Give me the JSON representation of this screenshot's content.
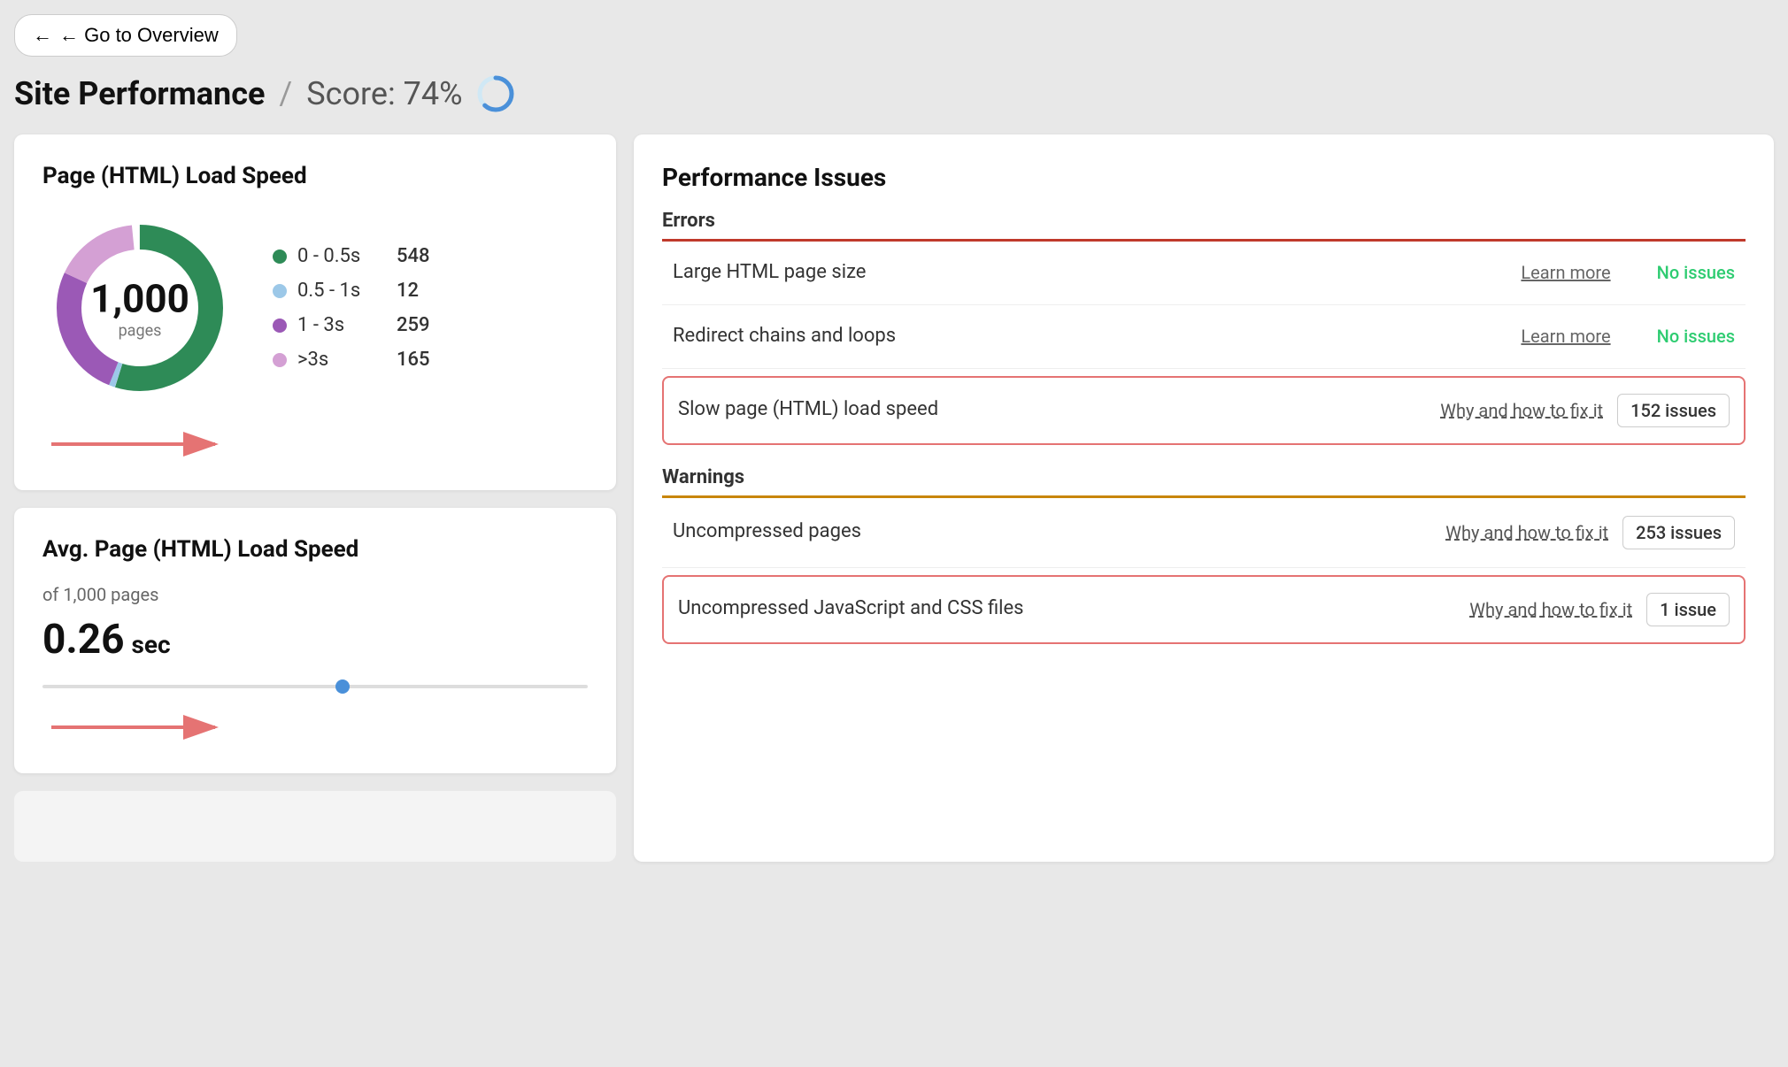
{
  "nav": {
    "back_button": "← Go to Overview"
  },
  "header": {
    "title": "Site Performance",
    "divider": "/",
    "score_label": "Score: 74%"
  },
  "left_panel": {
    "load_speed_card": {
      "title": "Page (HTML) Load Speed",
      "donut": {
        "total": "1,000",
        "label": "pages"
      },
      "legend": [
        {
          "color": "#2e8b57",
          "range": "0 - 0.5s",
          "count": "548"
        },
        {
          "color": "#9cc8e8",
          "range": "0.5 - 1s",
          "count": "12"
        },
        {
          "color": "#9b59b6",
          "range": "1 - 3s",
          "count": "259"
        },
        {
          "color": "#d4a0d4",
          "range": ">3s",
          "count": "165"
        }
      ]
    },
    "avg_card": {
      "title": "Avg. Page (HTML) Load Speed",
      "sub_text": "of 1,000 pages",
      "value": "0.26",
      "unit": "sec"
    }
  },
  "right_panel": {
    "title": "Performance Issues",
    "errors_section": {
      "label": "Errors",
      "rows": [
        {
          "name": "Large HTML page size",
          "link": "Learn more",
          "status": "No issues",
          "highlighted": false
        },
        {
          "name": "Redirect chains and loops",
          "link": "Learn more",
          "status": "No issues",
          "highlighted": false
        },
        {
          "name": "Slow page (HTML) load speed",
          "link": "Why and how to fix it",
          "count": "152 issues",
          "highlighted": true
        }
      ]
    },
    "warnings_section": {
      "label": "Warnings",
      "rows": [
        {
          "name": "Uncompressed pages",
          "link": "Why and how to fix it",
          "count": "253 issues",
          "highlighted": false
        },
        {
          "name": "Uncompressed JavaScript and CSS files",
          "link": "Why and how to fix it",
          "count": "1 issue",
          "highlighted": true
        }
      ]
    }
  },
  "donut_segments": {
    "fast": {
      "color": "#2e8b57",
      "value": 548
    },
    "medium_fast": {
      "color": "#9cc8e8",
      "value": 12
    },
    "medium_slow": {
      "color": "#9b59b6",
      "value": 259
    },
    "slow": {
      "color": "#d4a0d4",
      "value": 165
    }
  }
}
